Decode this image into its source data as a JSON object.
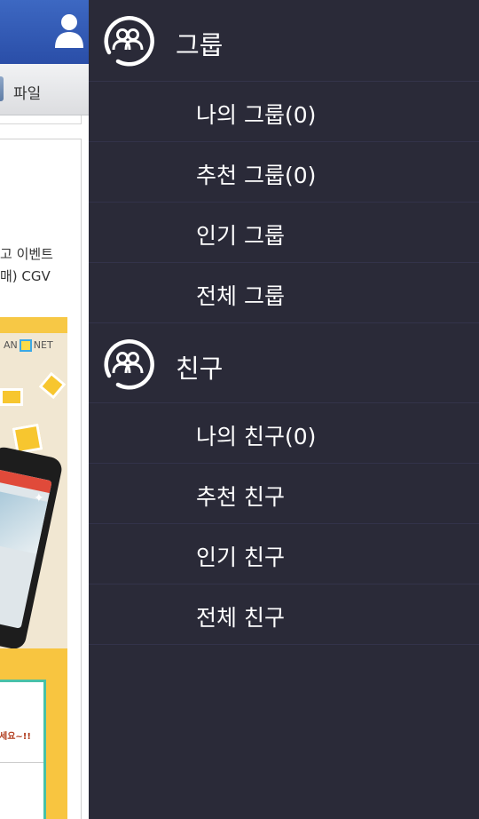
{
  "background_page": {
    "file_tab_label": "파일",
    "card_text_line1": "고 이벤트",
    "card_text_line2": "매) CGV",
    "banner_brand_left": "AN",
    "banner_brand_right": "NET",
    "banner_notice_text": "세요~!!"
  },
  "drawer": {
    "groups": {
      "title": "그룹",
      "icon": "group-icon",
      "items": [
        {
          "label": "나의 그룹(0)"
        },
        {
          "label": "추천 그룹(0)"
        },
        {
          "label": "인기 그룹"
        },
        {
          "label": "전체 그룹"
        }
      ]
    },
    "friends": {
      "title": "친구",
      "icon": "friends-icon",
      "items": [
        {
          "label": "나의 친구(0)"
        },
        {
          "label": "추천 친구"
        },
        {
          "label": "인기 친구"
        },
        {
          "label": "전체 친구"
        }
      ]
    }
  },
  "colors": {
    "drawer_bg": "#2a2a38",
    "top_bar": "#3457b2",
    "text": "#ffffff"
  }
}
